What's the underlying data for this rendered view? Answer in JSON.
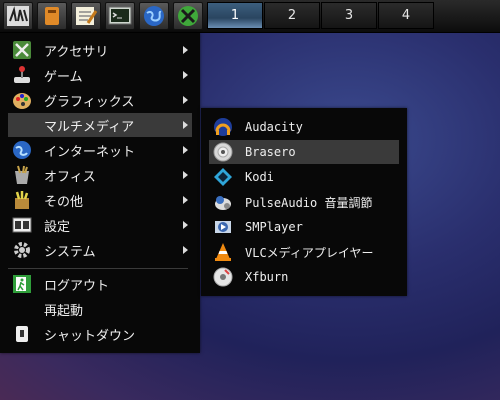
{
  "taskbar": {
    "launchers": [
      "lxde-logo-icon",
      "file-manager-icon",
      "text-editor-icon",
      "terminal-icon",
      "web-browser-icon",
      "exit-icon"
    ],
    "workspaces": [
      {
        "label": "1",
        "active": true
      },
      {
        "label": "2",
        "active": false
      },
      {
        "label": "3",
        "active": false
      },
      {
        "label": "4",
        "active": false
      }
    ]
  },
  "main_menu": {
    "items": [
      {
        "label": "アクセサリ",
        "icon": "accessories-icon",
        "submenu": true
      },
      {
        "label": "ゲーム",
        "icon": "games-icon",
        "submenu": true
      },
      {
        "label": "グラフィックス",
        "icon": "graphics-icon",
        "submenu": true
      },
      {
        "label": "マルチメディア",
        "icon": "",
        "submenu": true,
        "highlighted": true
      },
      {
        "label": "インターネット",
        "icon": "internet-icon",
        "submenu": true
      },
      {
        "label": "オフィス",
        "icon": "office-icon",
        "submenu": true
      },
      {
        "label": "その他",
        "icon": "other-icon",
        "submenu": true
      },
      {
        "label": "設定",
        "icon": "settings-icon",
        "submenu": true
      },
      {
        "label": "システム",
        "icon": "system-icon",
        "submenu": true
      }
    ],
    "session": [
      {
        "label": "ログアウト",
        "icon": "logout-icon"
      },
      {
        "label": "再起動",
        "icon": ""
      },
      {
        "label": "シャットダウン",
        "icon": "shutdown-icon"
      }
    ]
  },
  "multimedia_menu": {
    "items": [
      {
        "label": "Audacity",
        "icon": "audacity-icon"
      },
      {
        "label": "Brasero",
        "icon": "brasero-icon",
        "highlighted": true
      },
      {
        "label": "Kodi",
        "icon": "kodi-icon"
      },
      {
        "label": "PulseAudio 音量調節",
        "icon": "pulseaudio-icon"
      },
      {
        "label": "SMPlayer",
        "icon": "smplayer-icon"
      },
      {
        "label": "VLCメディアプレイヤー",
        "icon": "vlc-icon"
      },
      {
        "label": "Xfburn",
        "icon": "xfburn-icon"
      }
    ]
  }
}
